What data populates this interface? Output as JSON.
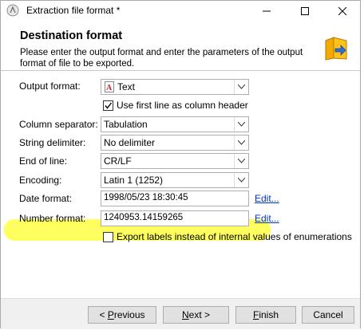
{
  "window": {
    "title": "Extraction file format *",
    "icons": [
      "app-icon",
      "minimize-icon",
      "maximize-icon",
      "close-icon"
    ]
  },
  "header": {
    "title": "Destination format",
    "subtitle": "Please enter the output format and enter the parameters of the output format of file to be exported.",
    "icon": "folder-export-icon"
  },
  "form": {
    "output_format": {
      "label": "Output format:",
      "value": "Text"
    },
    "first_line_header": {
      "label": "Use first line as column header",
      "checked": true
    },
    "column_separator": {
      "label": "Column separator:",
      "value": "Tabulation"
    },
    "string_delimiter": {
      "label": "String delimiter:",
      "value": "No delimiter"
    },
    "end_of_line": {
      "label": "End of line:",
      "value": "CR/LF"
    },
    "encoding": {
      "label": "Encoding:",
      "value": "Latin 1 (1252)"
    },
    "date_format": {
      "label": "Date format:",
      "value": "1998/05/23 18:30:45",
      "edit": "Edit..."
    },
    "number_format": {
      "label": "Number format:",
      "value": "1240953.14159265",
      "edit": "Edit..."
    },
    "export_labels": {
      "label": "Export labels instead of internal values of enumerations",
      "checked": false
    }
  },
  "buttons": {
    "previous_mnemonic": "P",
    "previous_rest": "revious",
    "previous_prefix": "< ",
    "next_mnemonic": "N",
    "next_rest": "ext >",
    "finish_mnemonic": "F",
    "finish_rest": "inish",
    "cancel": "Cancel"
  },
  "colors": {
    "highlight": "#ffff2a",
    "link": "#0033cc"
  }
}
